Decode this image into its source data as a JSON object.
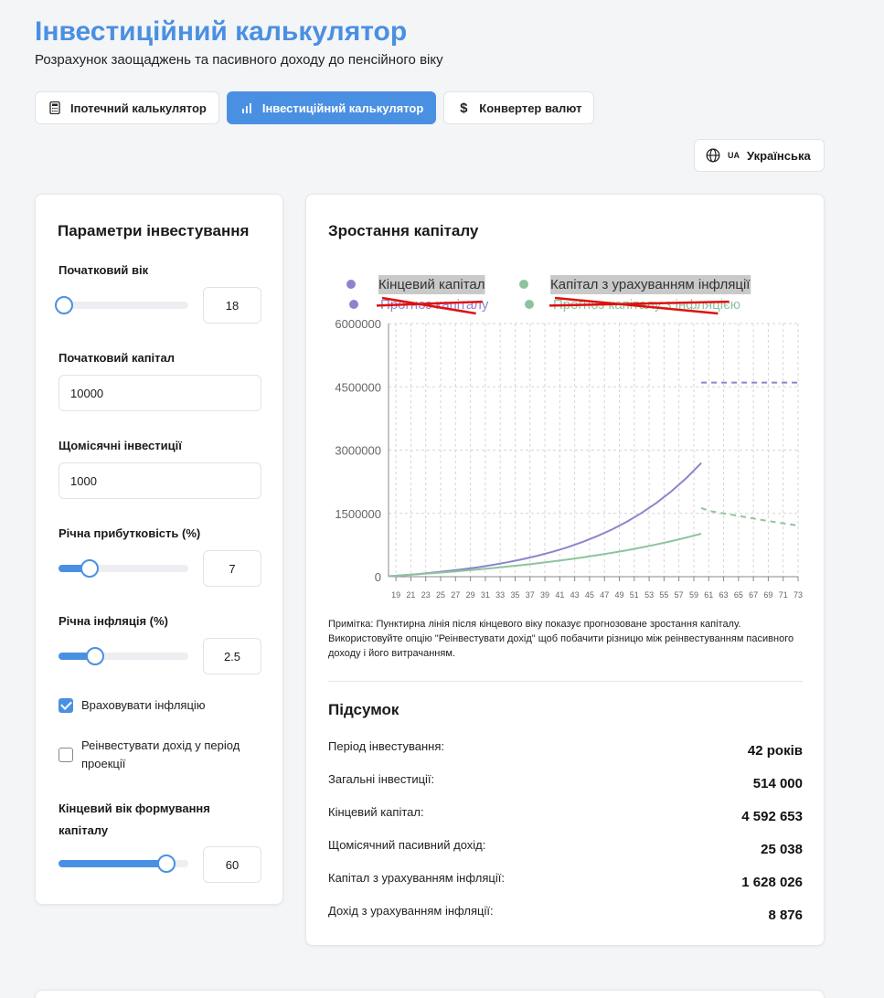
{
  "header": {
    "title": "Інвестиційний калькулятор",
    "subtitle": "Розрахунок заощаджень та пасивного доходу до пенсійного віку"
  },
  "tabs": [
    {
      "label": "Іпотечний калькулятор",
      "icon": "calculator-icon",
      "active": false
    },
    {
      "label": "Інвестиційний калькулятор",
      "icon": "bar-chart-icon",
      "active": true
    },
    {
      "label": "Конвертер валют",
      "icon": "dollar-icon",
      "active": false
    }
  ],
  "language": {
    "code": "UA",
    "label": "Українська",
    "icon": "globe-icon"
  },
  "params": {
    "title": "Параметри інвестування",
    "start_age": {
      "label": "Початковий вік",
      "value": "18",
      "slider_fraction": 0.04
    },
    "initial_capital": {
      "label": "Початковий капітал",
      "value": "10000"
    },
    "monthly": {
      "label": "Щомісячні інвестиції",
      "value": "1000"
    },
    "annual_return": {
      "label": "Річна прибутковість (%)",
      "value": "7",
      "slider_fraction": 0.24
    },
    "inflation": {
      "label": "Річна інфляція (%)",
      "value": "2.5",
      "slider_fraction": 0.28
    },
    "account_inflation": {
      "label": "Враховувати інфляцію",
      "checked": true
    },
    "reinvest": {
      "label": "Реінвестувати дохід у період проекції",
      "checked": false
    },
    "final_age": {
      "label": "Кінцевий вік формування капіталу",
      "value": "60",
      "slider_fraction": 0.83
    }
  },
  "chart_section": {
    "title": "Зростання капіталу",
    "note": "Примітка: Пунктирна лінія після кінцевого віку показує прогнозоване зростання капіталу. Використовуйте опцію \"Реінвестувати дохід\" щоб побачити різницю між реінвестуванням пасивного доходу і його витрачанням."
  },
  "chart_data": {
    "type": "line",
    "legend": [
      {
        "name": "Кінцевий капітал",
        "color": "#8e84cc",
        "hidden": false
      },
      {
        "name": "Капітал з урахуванням інфляції",
        "color": "#8ec49d",
        "hidden": false
      },
      {
        "name": "Прогноз капіталу",
        "color": "#8e84cc",
        "hidden": true
      },
      {
        "name": "Прогноз капіталу з інфляцією",
        "color": "#8ec49d",
        "hidden": true
      }
    ],
    "x_ticks": [
      "19",
      "21",
      "23",
      "25",
      "27",
      "29",
      "31",
      "33",
      "35",
      "37",
      "39",
      "41",
      "43",
      "45",
      "47",
      "49",
      "51",
      "53",
      "55",
      "57",
      "59",
      "61",
      "63",
      "65",
      "67",
      "69",
      "71",
      "73"
    ],
    "y_ticks": [
      "0",
      "1500000",
      "3000000",
      "4500000",
      "6000000"
    ],
    "xlim": [
      18,
      73
    ],
    "ylim": [
      0,
      6000000
    ],
    "grid": true,
    "series": [
      {
        "name": "Кінцевий капітал",
        "color": "#8e84cc",
        "style": "solid",
        "x": [
          18,
          20,
          22,
          24,
          26,
          28,
          30,
          32,
          34,
          36,
          38,
          40,
          42,
          44,
          46,
          48,
          50,
          52,
          54,
          56,
          58,
          60
        ],
        "y": [
          10000,
          35250,
          63800,
          96450,
          133500,
          175800,
          224000,
          279000,
          342000,
          413500,
          495500,
          589000,
          696000,
          818500,
          958500,
          1118500,
          1301500,
          1511000,
          1750500,
          2024500,
          2337500,
          2695000
        ]
      },
      {
        "name": "Капітал з урахуванням інфляції",
        "color": "#8ec49d",
        "style": "solid",
        "x": [
          18,
          20,
          22,
          24,
          26,
          28,
          30,
          32,
          34,
          36,
          38,
          40,
          42,
          44,
          46,
          48,
          50,
          52,
          54,
          56,
          58,
          60
        ],
        "y": [
          10000,
          33500,
          58000,
          84000,
          111500,
          140500,
          171500,
          204500,
          239500,
          277000,
          317000,
          360000,
          406000,
          455500,
          508500,
          565500,
          627000,
          693500,
          765000,
          842500,
          926500,
          1018000
        ]
      },
      {
        "name": "Прогноз капіталу",
        "color": "#8e84cc",
        "style": "dashed",
        "x": [
          60,
          61,
          63,
          65,
          67,
          69,
          71,
          73
        ],
        "y": [
          4600000,
          4600000,
          4600000,
          4600000,
          4600000,
          4600000,
          4600000,
          4600000
        ]
      },
      {
        "name": "Прогноз капіталу з інфляцією",
        "color": "#8ec49d",
        "style": "dashed",
        "x": [
          60,
          61,
          63,
          65,
          67,
          69,
          71,
          73
        ],
        "y": [
          1628026,
          1560000,
          1500000,
          1440000,
          1380000,
          1320000,
          1265000,
          1210000
        ]
      }
    ]
  },
  "summary": {
    "title": "Підсумок",
    "rows": [
      {
        "label": "Період інвестування:",
        "value": "42 років"
      },
      {
        "label": "Загальні інвестиції:",
        "value": "514 000"
      },
      {
        "label": "Кінцевий капітал:",
        "value": "4 592 653"
      },
      {
        "label": "Щомісячний пасивний дохід:",
        "value": "25 038"
      },
      {
        "label": "Капітал з урахуванням інфляції:",
        "value": "1 628 026"
      },
      {
        "label": "Дохід з урахуванням інфляції:",
        "value": "8 876"
      }
    ]
  }
}
